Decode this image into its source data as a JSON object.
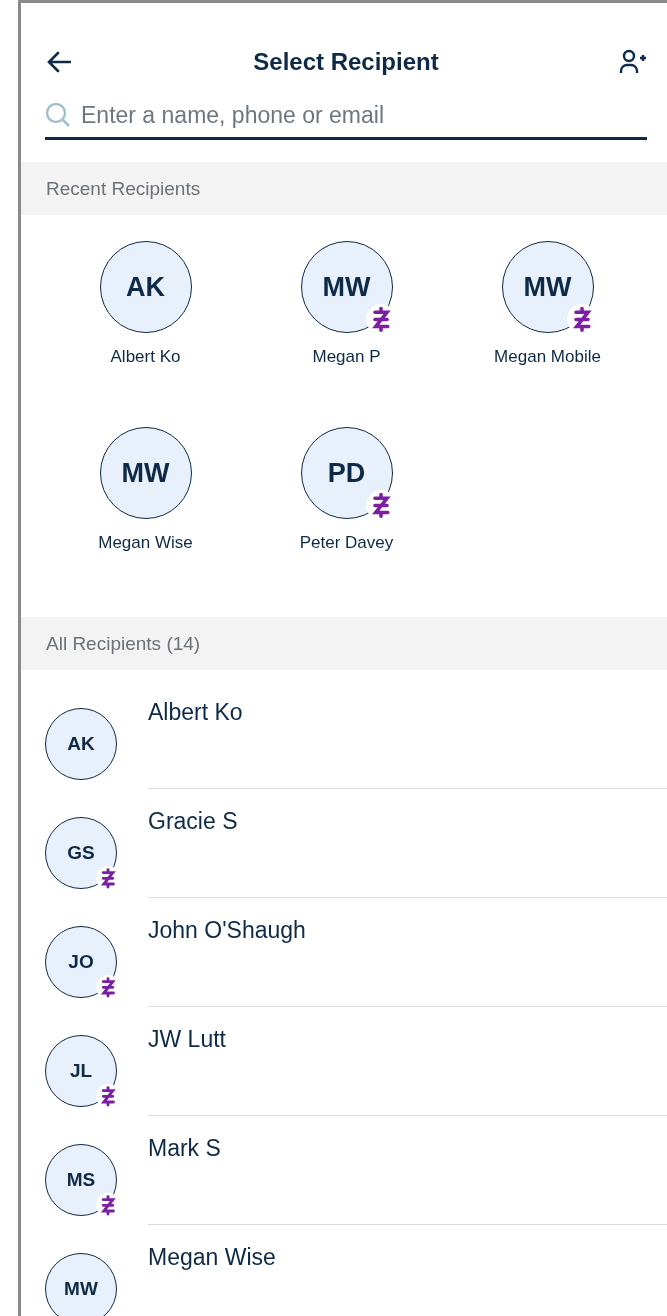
{
  "header": {
    "title": "Select Recipient"
  },
  "search": {
    "placeholder": "Enter a name, phone or email"
  },
  "recent": {
    "title": "Recent Recipients",
    "items": [
      {
        "initials": "AK",
        "name": "Albert Ko",
        "badge": false
      },
      {
        "initials": "MW",
        "name": "Megan P",
        "badge": true
      },
      {
        "initials": "MW",
        "name": "Megan Mobile",
        "badge": true
      },
      {
        "initials": "MW",
        "name": "Megan Wise",
        "badge": false
      },
      {
        "initials": "PD",
        "name": "Peter Davey",
        "badge": true
      }
    ]
  },
  "all": {
    "title": "All Recipients (14)",
    "items": [
      {
        "initials": "AK",
        "name": "Albert Ko",
        "badge": false
      },
      {
        "initials": "GS",
        "name": "Gracie S",
        "badge": true
      },
      {
        "initials": "JO",
        "name": "John O'Shaugh",
        "badge": true
      },
      {
        "initials": "JL",
        "name": "JW Lutt",
        "badge": true
      },
      {
        "initials": "MS",
        "name": "Mark S",
        "badge": true
      },
      {
        "initials": "MW",
        "name": "Megan Wise",
        "badge": false
      }
    ]
  }
}
